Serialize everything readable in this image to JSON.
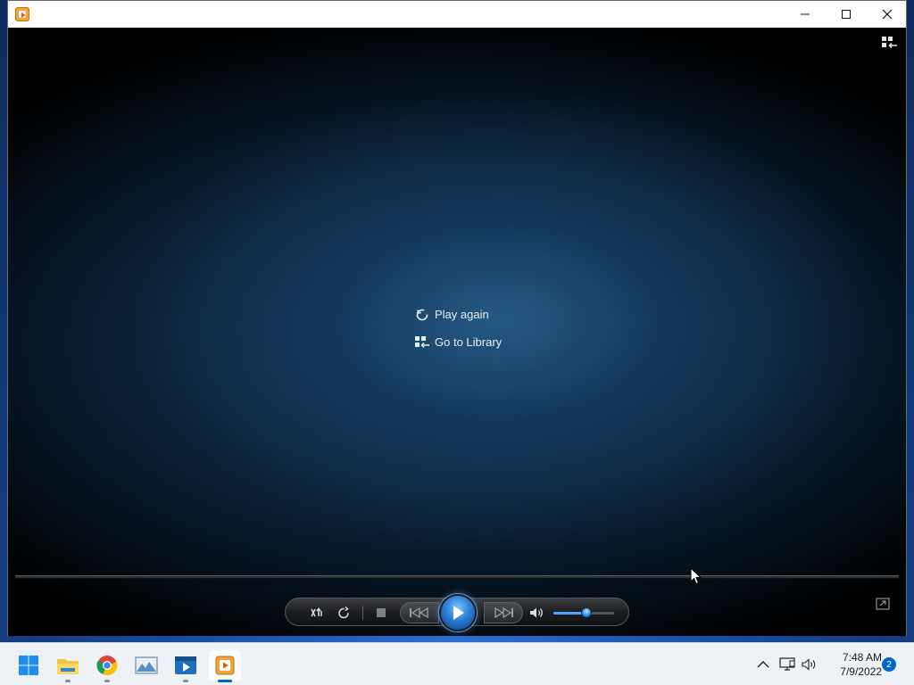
{
  "window": {
    "controls": {
      "minimize_icon": "minimize-icon",
      "maximize_icon": "maximize-icon",
      "close_icon": "close-icon"
    }
  },
  "player": {
    "overlay_menu": {
      "items": [
        {
          "label": "Play again",
          "icon": "replay-icon"
        },
        {
          "label": "Go to Library",
          "icon": "library-icon"
        }
      ]
    },
    "seek_position": 0,
    "volume_level": 0.55,
    "accent_color": "#2a7fd8"
  },
  "taskbar": {
    "apps": [
      {
        "name": "Start",
        "icon": "windows-start-icon"
      },
      {
        "name": "File Explorer",
        "icon": "folder-icon",
        "running": true
      },
      {
        "name": "Google Chrome",
        "icon": "chrome-icon",
        "running": true
      },
      {
        "name": "Photos",
        "icon": "photos-icon"
      },
      {
        "name": "Media Player",
        "icon": "media-player-icon",
        "running": true
      },
      {
        "name": "Windows Media Player",
        "icon": "wmp-icon",
        "active": true
      }
    ],
    "clock": {
      "time": "7:48 AM",
      "date": "7/9/2022"
    },
    "notification_count": "2"
  }
}
